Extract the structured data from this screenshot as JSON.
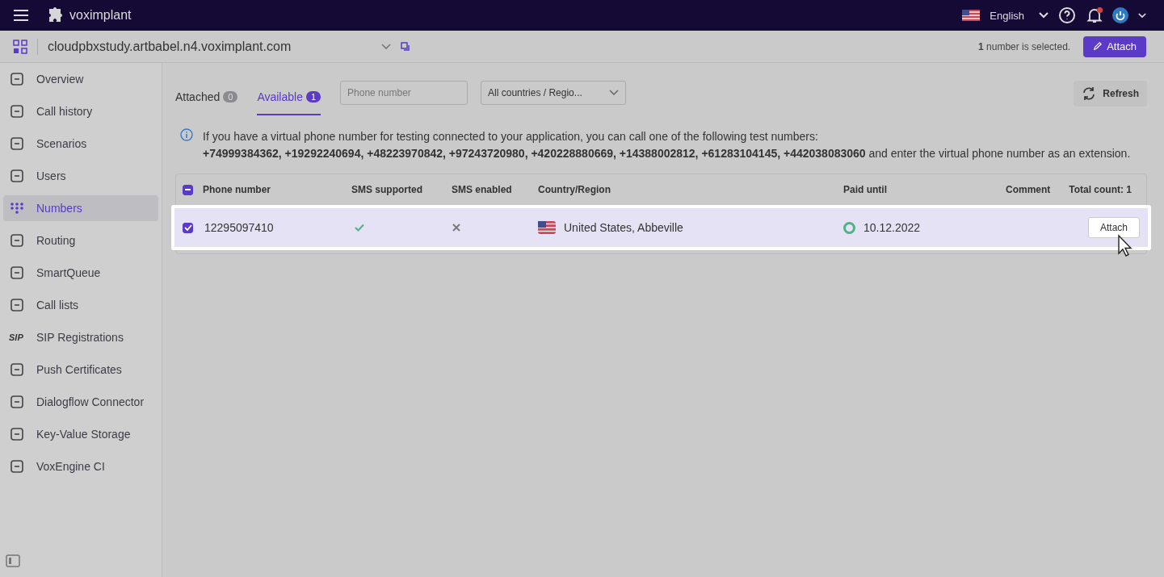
{
  "topbar": {
    "brand": "voximplant",
    "language": "English",
    "has_notification": true
  },
  "appbar": {
    "app_name": "cloudpbxstudy.artbabel.n4.voximplant.com",
    "selection_count": "1",
    "selection_text": "number is selected.",
    "attach_label": "Attach"
  },
  "sidebar": {
    "items": [
      {
        "label": "Overview",
        "selected": false
      },
      {
        "label": "Call history",
        "selected": false
      },
      {
        "label": "Scenarios",
        "selected": false
      },
      {
        "label": "Users",
        "selected": false
      },
      {
        "label": "Numbers",
        "selected": true
      },
      {
        "label": "Routing",
        "selected": false
      },
      {
        "label": "SmartQueue",
        "selected": false
      },
      {
        "label": "Call lists",
        "selected": false
      },
      {
        "label": "SIP Registrations",
        "selected": false,
        "icon_text": "SIP"
      },
      {
        "label": "Push Certificates",
        "selected": false
      },
      {
        "label": "Dialogflow Connector",
        "selected": false
      },
      {
        "label": "Key-Value Storage",
        "selected": false
      },
      {
        "label": "VoxEngine CI",
        "selected": false
      }
    ]
  },
  "tabs": [
    {
      "label": "Attached",
      "count": "0",
      "selected": false
    },
    {
      "label": "Available",
      "count": "1",
      "selected": true
    }
  ],
  "search": {
    "placeholder": "Phone number"
  },
  "country_filter": {
    "value": "All countries / Regio..."
  },
  "refresh_label": "Refresh",
  "info": {
    "lines": [
      "If you have a virtual phone number for testing connected to your application, you can call one of the following test numbers:",
      "**+74999384362, +19292240694, +48223970842, +97243720980, +420228880669, +14388002812, +61283104145, +442038083060** and enter the virtual phone number as an extension."
    ]
  },
  "table": {
    "select_all_indeterminate": true,
    "columns": [
      "Phone number",
      "SMS supported",
      "SMS enabled",
      "Country/Region",
      "Paid until",
      "Comment"
    ],
    "total_count": "Total count: 1",
    "rows": [
      {
        "selected": true,
        "phone": "12295097410",
        "sms_supported": true,
        "sms_enabled": false,
        "country": "United States, Abbeville",
        "color": "#4fb386",
        "paid_until": "10.12.2022",
        "action": "Attach"
      }
    ]
  }
}
